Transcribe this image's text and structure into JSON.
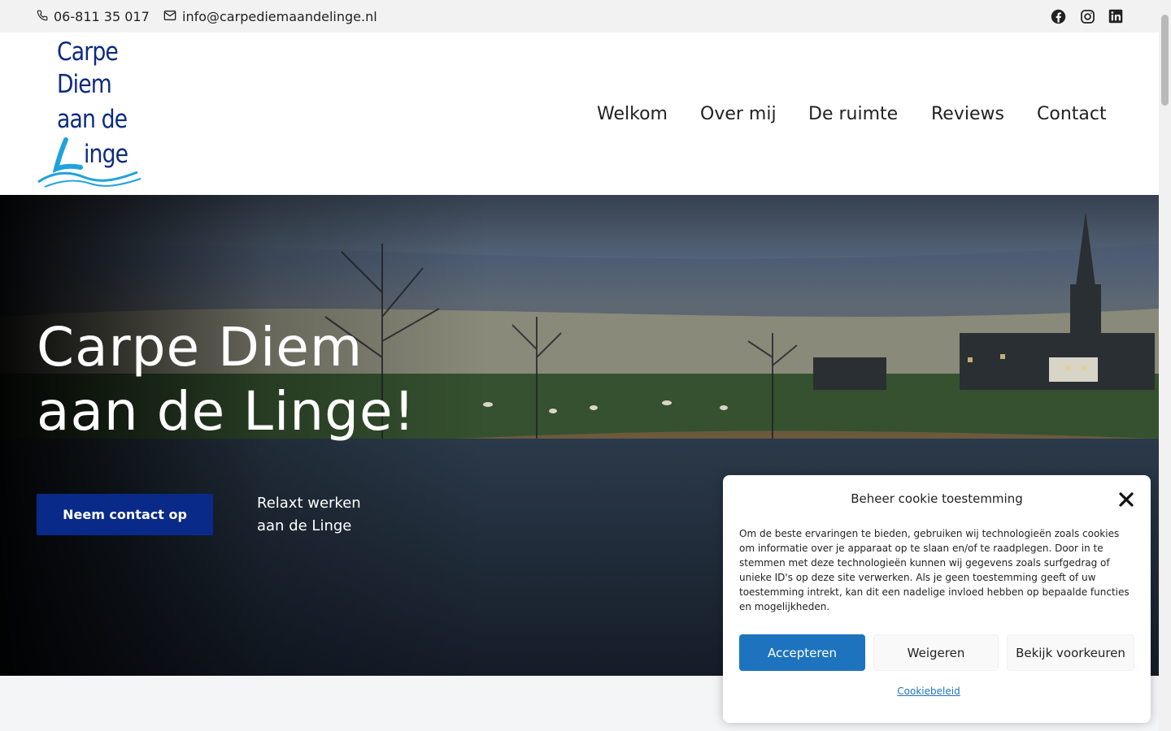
{
  "topbar": {
    "phone": "06-811 35 017",
    "email": "info@carpediemaandelinge.nl",
    "social": [
      "facebook-icon",
      "instagram-icon",
      "linkedin-icon"
    ]
  },
  "logo": {
    "line1": "Carpe",
    "line2": "Diem",
    "line3": "aan de",
    "line4": "inge",
    "colors": {
      "dark": "#0d2b80",
      "accent": "#1ea3dc"
    }
  },
  "nav": {
    "items": [
      "Welkom",
      "Over mij",
      "De ruimte",
      "Reviews",
      "Contact"
    ]
  },
  "hero": {
    "title_line1": "Carpe Diem",
    "title_line2": "aan de Linge!",
    "button": "Neem contact op",
    "tagline_line1": "Relaxt werken",
    "tagline_line2": "aan de Linge"
  },
  "cookie": {
    "title": "Beheer cookie toestemming",
    "text": "Om de beste ervaringen te bieden, gebruiken wij technologieën zoals cookies om informatie over je apparaat op te slaan en/of te raadplegen. Door in te stemmen met deze technologieën kunnen wij gegevens zoals surfgedrag of unieke ID's op deze site verwerken. Als je geen toestemming geeft of uw toestemming intrekt, kan dit een nadelige invloed hebben op bepaalde functies en mogelijkheden.",
    "accept": "Accepteren",
    "deny": "Weigeren",
    "prefs": "Bekijk voorkeuren",
    "policy_link": "Cookiebeleid"
  },
  "colors": {
    "primary": "#0a2a8a",
    "cookie_accept": "#1e73be"
  }
}
